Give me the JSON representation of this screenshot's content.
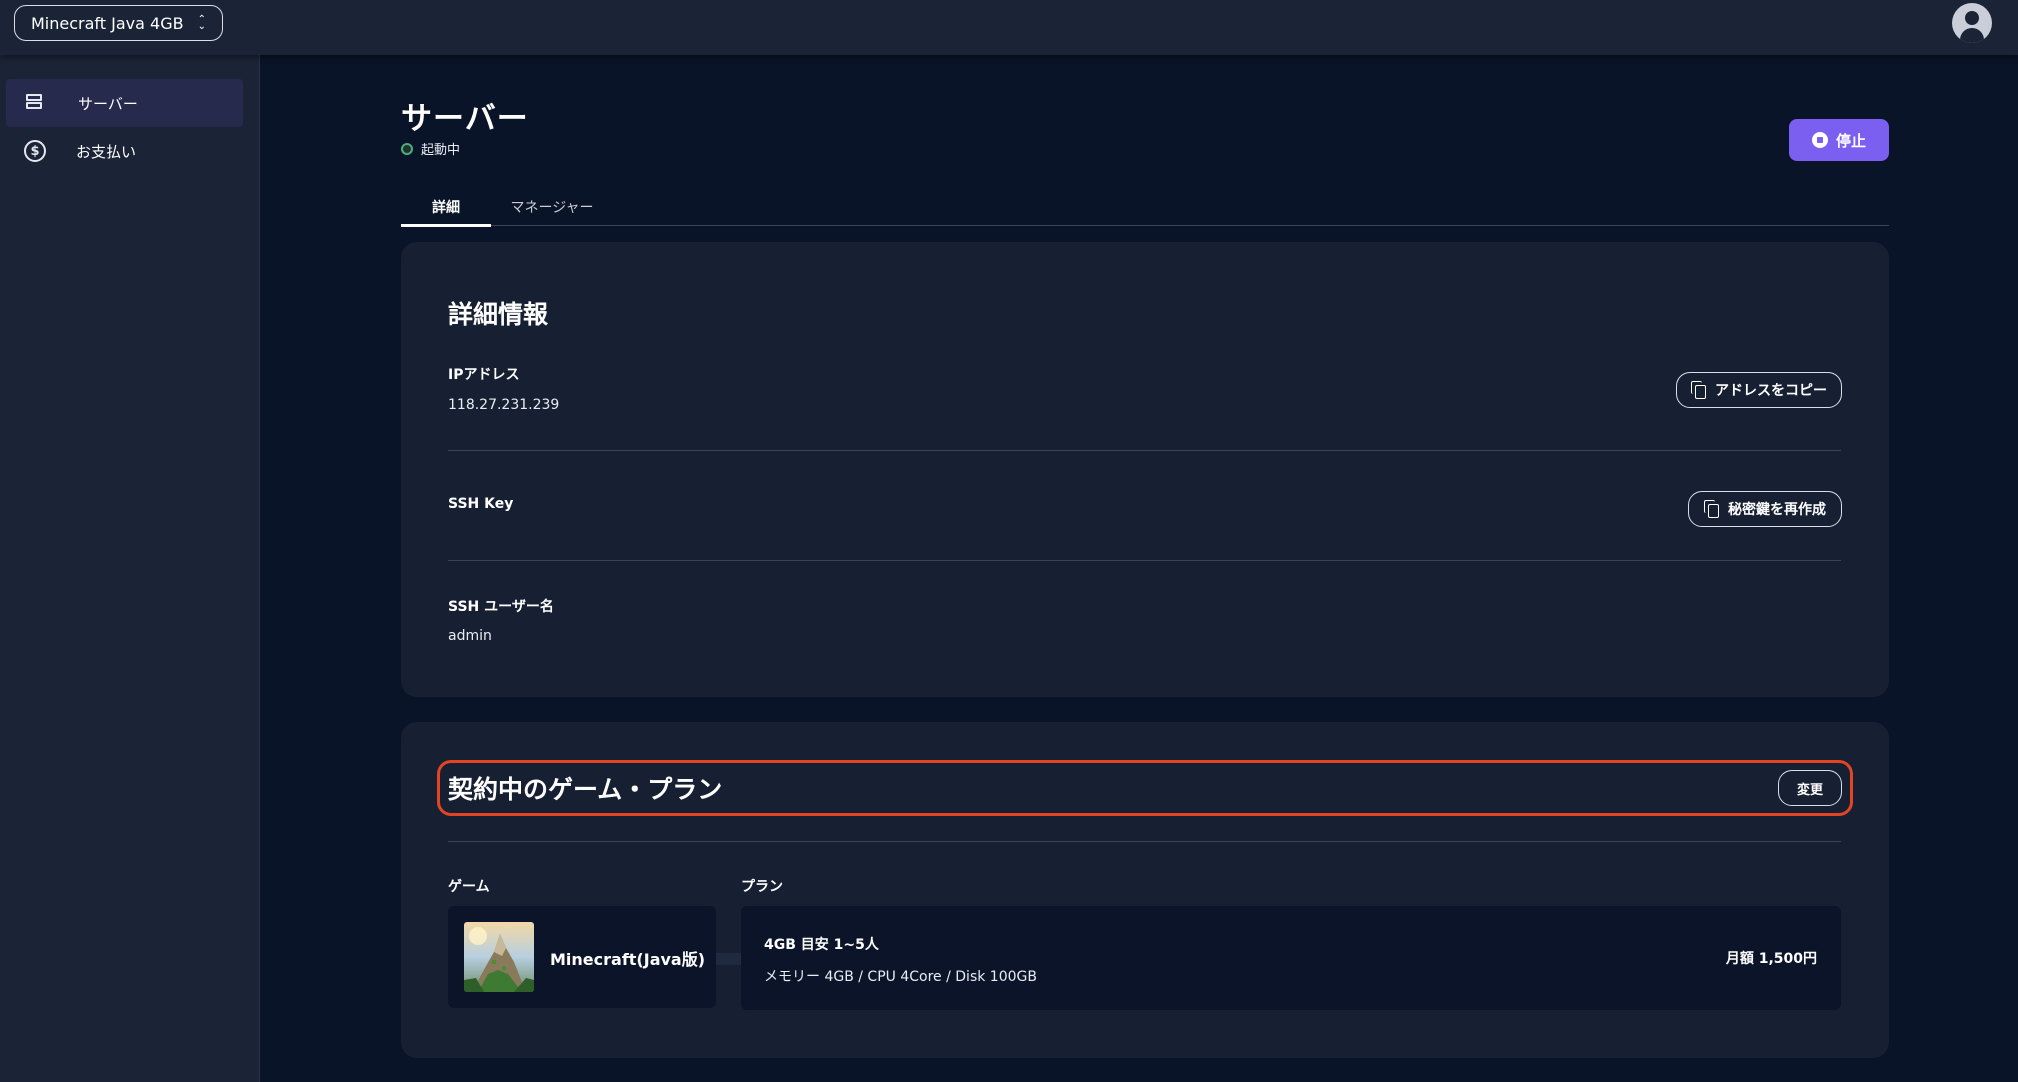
{
  "topbar": {
    "server_select_label": "Minecraft Java 4GB"
  },
  "sidebar": {
    "items": [
      {
        "label": "サーバー",
        "icon": "server-icon",
        "active": true
      },
      {
        "label": "お支払い",
        "icon": "dollar-icon",
        "active": false
      }
    ]
  },
  "header": {
    "title": "サーバー",
    "status": "起動中",
    "stop_label": "停止"
  },
  "tabs": [
    {
      "label": "詳細",
      "active": true
    },
    {
      "label": "マネージャー",
      "active": false
    }
  ],
  "details": {
    "title": "詳細情報",
    "ip_label": "IPアドレス",
    "ip_value": "118.27.231.239",
    "copy_label": "アドレスをコピー",
    "ssh_key_label": "SSH Key",
    "regen_label": "秘密鍵を再作成",
    "ssh_user_label": "SSH ユーザー名",
    "ssh_user_value": "admin"
  },
  "plan": {
    "title": "契約中のゲーム・プラン",
    "change_label": "変更",
    "game_label": "ゲーム",
    "plan_label": "プラン",
    "game_name": "Minecraft(Java版)",
    "plan_line1": "4GB 目安 1~5人",
    "plan_line2": "メモリー 4GB / CPU 4Core / Disk 100GB",
    "price": "月額 1,500円"
  },
  "colors": {
    "accent": "#7a5ff0",
    "highlight": "#e24424",
    "status_running": "#4caf7a"
  }
}
